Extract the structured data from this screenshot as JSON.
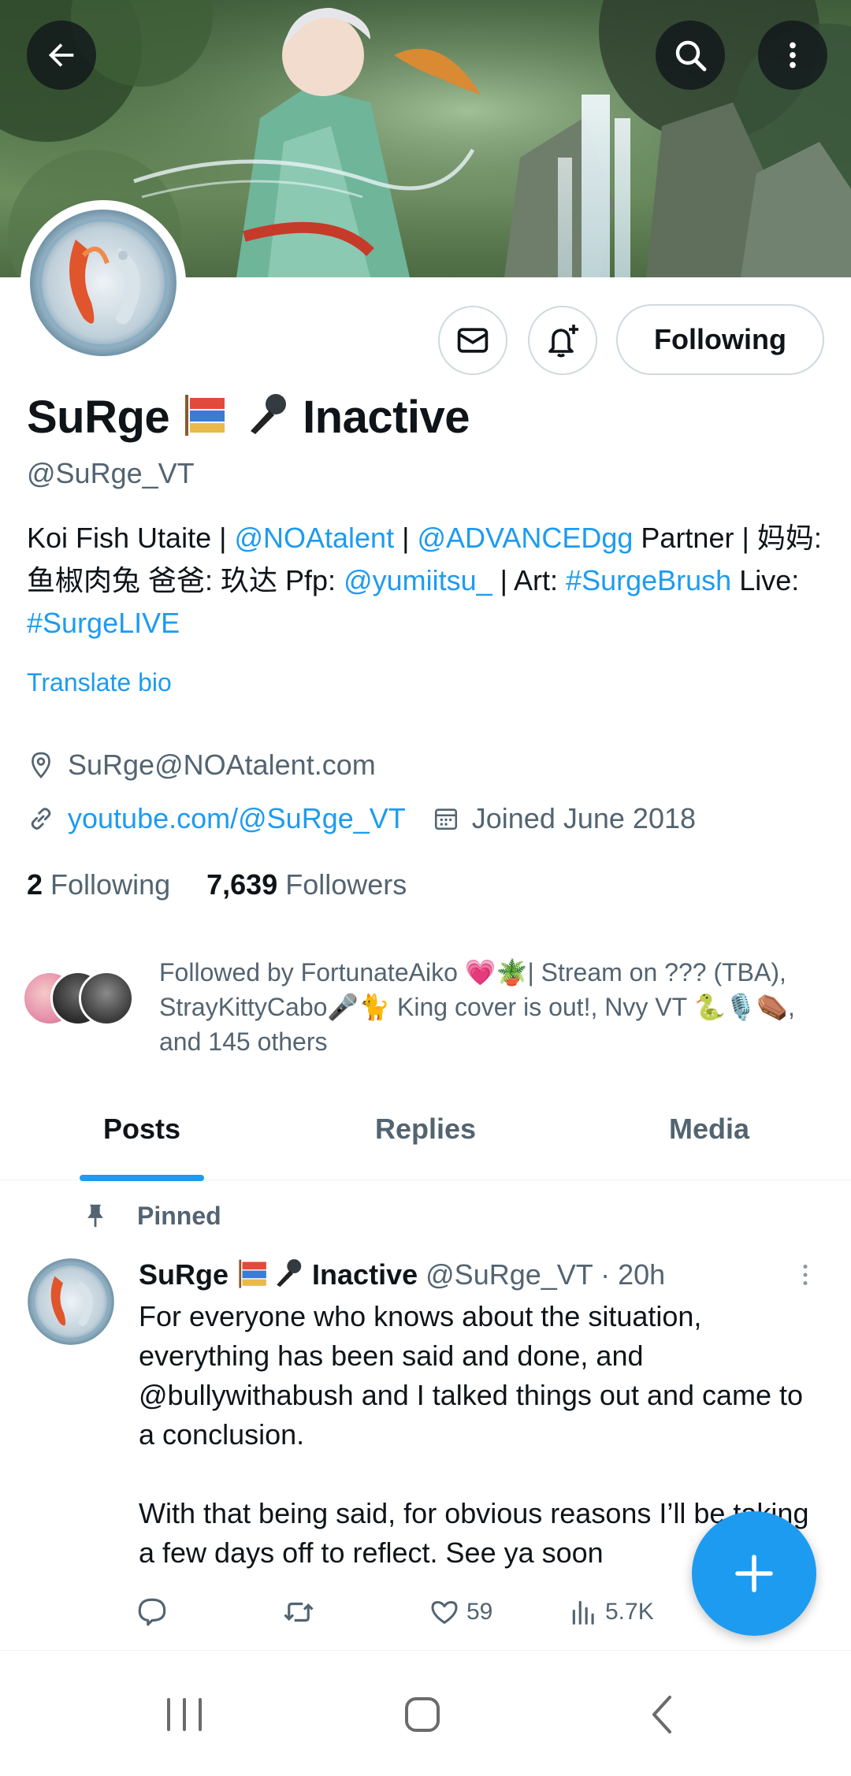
{
  "profile": {
    "name_first": "SuRge",
    "name_suffix": "Inactive",
    "handle": "@SuRge_VT",
    "bio": {
      "t1": "Koi Fish Utaite | ",
      "l1": "@NOAtalent",
      "t2": " | ",
      "l2": "@ADVANCEDgg",
      "t3": " Partner | 妈妈: 鱼椒肉兔 爸爸: 玖达 Pfp: ",
      "l3": "@yumiitsu_",
      "t4": " | Art: ",
      "l4": "#SurgeBrush",
      "t5": " Live: ",
      "l5": "#SurgeLIVE"
    },
    "translate_label": "Translate bio",
    "email": "SuRge@NOAtalent.com",
    "website": "youtube.com/@SuRge_VT",
    "joined": "Joined June 2018",
    "following_count": "2",
    "following_label": "Following",
    "followers_count": "7,639",
    "followers_label": "Followers",
    "followed_by": "Followed by FortunateAiko 💗🪴| Stream on ??? (TBA), StrayKittyCabo🎤🐈 King cover is out!, Nvy VT 🐍🎙️⚰️, and 145 others"
  },
  "actions": {
    "following_button": "Following"
  },
  "tabs": [
    {
      "label": "Posts",
      "active": true
    },
    {
      "label": "Replies",
      "active": false
    },
    {
      "label": "Media",
      "active": false
    }
  ],
  "pinned_post": {
    "pinned_label": "Pinned",
    "author_name": "SuRge",
    "author_suffix": "Inactive",
    "meta": "@SuRge_VT · 20h",
    "text": "For everyone who knows about the situation, everything has been said and done, and @bullywithabush and I talked things out and came to a conclusion.\n\nWith that being said, for obvious reasons I’ll be taking a few days off to reflect. See ya soon",
    "likes": "59",
    "views": "5.7K"
  },
  "colors": {
    "accent": "#1d9bf0",
    "text_primary": "#0f1419",
    "text_secondary": "#536471",
    "border": "#cfd9de"
  },
  "icons": {
    "back": "arrow-left-icon",
    "search": "search-icon",
    "more": "more-vertical-icon",
    "message": "envelope-icon",
    "notify": "bell-plus-icon",
    "location": "location-pin-icon",
    "link": "link-icon",
    "calendar": "calendar-icon",
    "pin": "pin-icon",
    "reply": "reply-icon",
    "retweet": "retweet-icon",
    "like": "heart-icon",
    "views": "views-chart-icon",
    "compose": "plus-icon"
  }
}
